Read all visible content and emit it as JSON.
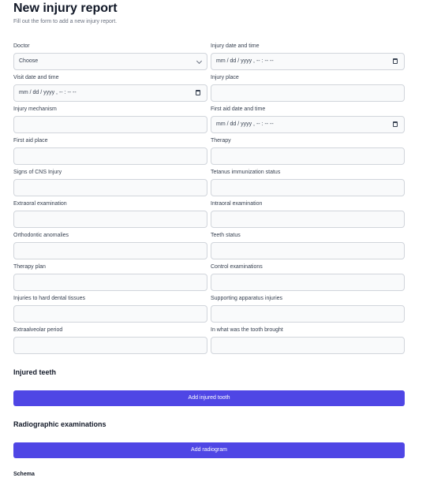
{
  "header": {
    "title": "New injury report",
    "subtitle": "Fill out the form to add a new injury report."
  },
  "form": {
    "fields": [
      {
        "label": "Doctor",
        "kind": "select",
        "value": "Choose"
      },
      {
        "label": "Injury date and time",
        "kind": "datetime",
        "value": "mm / dd / yyyy ,  -- : --   --"
      },
      {
        "label": "Visit date and time",
        "kind": "datetime",
        "value": "mm / dd / yyyy ,  -- : --   --"
      },
      {
        "label": "Injury place",
        "kind": "text",
        "value": ""
      },
      {
        "label": "Injury mechanism",
        "kind": "text",
        "value": ""
      },
      {
        "label": "First aid date and time",
        "kind": "datetime",
        "value": "mm / dd / yyyy ,  -- : --   --"
      },
      {
        "label": "First aid place",
        "kind": "text",
        "value": ""
      },
      {
        "label": "Therapy",
        "kind": "text",
        "value": ""
      },
      {
        "label": "Signs of CNS Injury",
        "kind": "text",
        "value": ""
      },
      {
        "label": "Tetanus immunization status",
        "kind": "text",
        "value": ""
      },
      {
        "label": "Extraoral examination",
        "kind": "text",
        "value": ""
      },
      {
        "label": "Intraoral examination",
        "kind": "text",
        "value": ""
      },
      {
        "label": "Orthodontic anomalies",
        "kind": "text",
        "value": ""
      },
      {
        "label": "Teeth status",
        "kind": "text",
        "value": ""
      },
      {
        "label": "Therapy plan",
        "kind": "text",
        "value": ""
      },
      {
        "label": "Control examinations",
        "kind": "text",
        "value": ""
      },
      {
        "label": "Injuries to hard dental tissues",
        "kind": "text",
        "value": ""
      },
      {
        "label": "Supporting apparatus injuries",
        "kind": "text",
        "value": ""
      },
      {
        "label": "Extraalveolar period",
        "kind": "text",
        "value": ""
      },
      {
        "label": "In what was the tooth brought",
        "kind": "text",
        "value": ""
      }
    ]
  },
  "injured_teeth": {
    "heading": "Injured teeth",
    "button_label": "Add injured tooth"
  },
  "radiographic": {
    "heading": "Radiographic examinations",
    "button_label": "Add radiogram"
  },
  "schema": {
    "label": "Schema"
  },
  "colors": {
    "accent": "#4f46e5",
    "input_border": "#d1d5db",
    "input_bg": "#f9fafb"
  }
}
